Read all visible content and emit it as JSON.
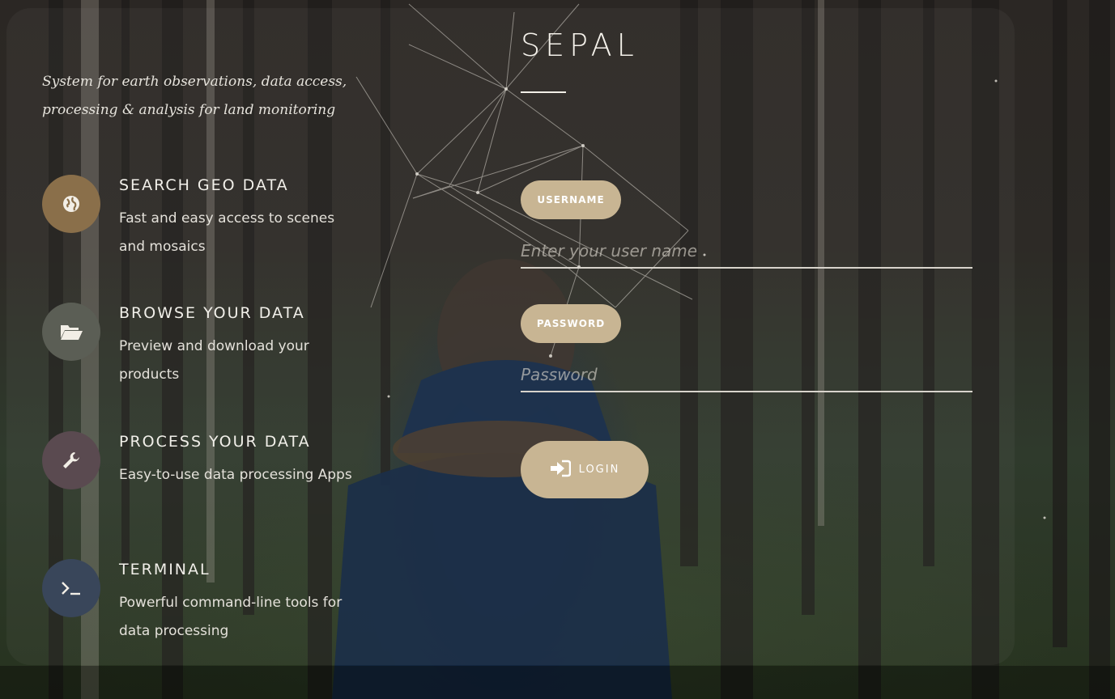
{
  "app": {
    "name": "SEPAL",
    "tagline": "System for earth observations, data access, processing & analysis for land monitoring"
  },
  "features": [
    {
      "title": "SEARCH GEO DATA",
      "description": "Fast and easy access to scenes and mosaics",
      "icon": "globe-icon",
      "color": "#8a6f4a"
    },
    {
      "title": "BROWSE YOUR DATA",
      "description": "Preview and download your products",
      "icon": "folder-open-icon",
      "color": "#5b5e55"
    },
    {
      "title": "PROCESS YOUR DATA",
      "description": "Easy-to-use data processing Apps",
      "icon": "wrench-icon",
      "color": "#5a4a50"
    },
    {
      "title": "TERMINAL",
      "description": "Powerful command-line tools for data processing",
      "icon": "terminal-icon",
      "color": "#39465a"
    }
  ],
  "login_form": {
    "username_label": "USERNAME",
    "username_placeholder": "Enter your user name",
    "password_label": "PASSWORD",
    "password_placeholder": "Password",
    "login_label": "LOGIN",
    "accent_color": "#c8b593"
  }
}
